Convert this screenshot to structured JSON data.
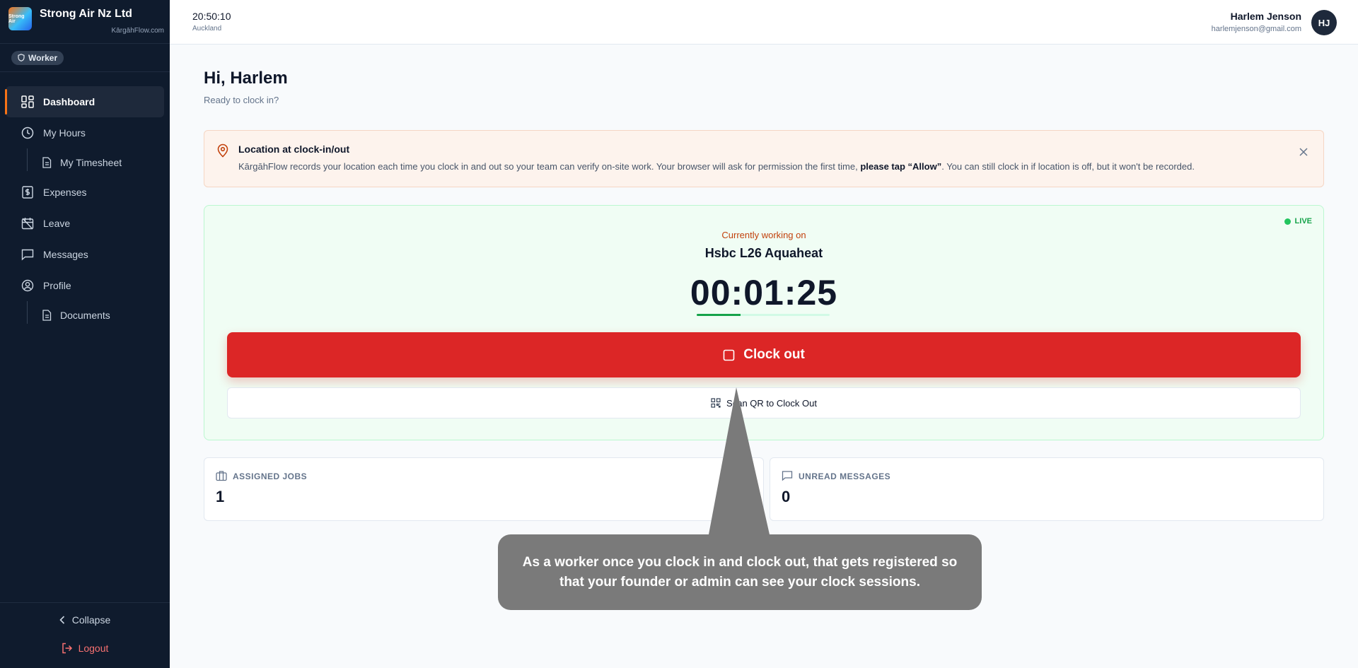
{
  "brand": {
    "name": "Strong Air Nz Ltd",
    "subtitle": "KārgāhFlow.com",
    "logo_text": "Strong Air"
  },
  "role": {
    "label": "Worker"
  },
  "nav": {
    "dashboard": "Dashboard",
    "my_hours": "My Hours",
    "my_timesheet": "My Timesheet",
    "expenses": "Expenses",
    "leave": "Leave",
    "messages": "Messages",
    "profile": "Profile",
    "documents": "Documents"
  },
  "sidebar_bottom": {
    "collapse": "Collapse",
    "logout": "Logout"
  },
  "header": {
    "time": "20:50:10",
    "timezone": "Auckland",
    "user_name": "Harlem Jenson",
    "user_email": "harlemjenson@gmail.com",
    "avatar_initials": "HJ"
  },
  "greeting": {
    "title": "Hi, Harlem",
    "subtitle": "Ready to clock in?"
  },
  "alert": {
    "title": "Location at clock-in/out",
    "text_before": "KārgāhFlow records your location each time you clock in and out so your team can verify on-site work. Your browser will ask for permission the first time, ",
    "text_bold": "please tap “Allow”",
    "text_after": ". You can still clock in if location is off, but it won't be recorded."
  },
  "work": {
    "live_label": "LIVE",
    "working_label": "Currently working on",
    "job_name": "Hsbc L26 Aquaheat",
    "timer": "00:01:25",
    "timer_progress": 0.33,
    "clock_out_label": "Clock out",
    "qr_label": "Scan QR to Clock Out"
  },
  "stats": {
    "assigned_jobs_label": "ASSIGNED JOBS",
    "assigned_jobs_value": "1",
    "unread_messages_label": "UNREAD MESSAGES",
    "unread_messages_value": "0"
  },
  "tooltip": {
    "text": "As a worker once you clock in and clock out, that gets registered so that your founder or admin can see your clock sessions."
  },
  "colors": {
    "accent": "#f97316",
    "danger": "#dc2626",
    "live": "#22c55e",
    "sidebar": "#0f1b2d"
  }
}
